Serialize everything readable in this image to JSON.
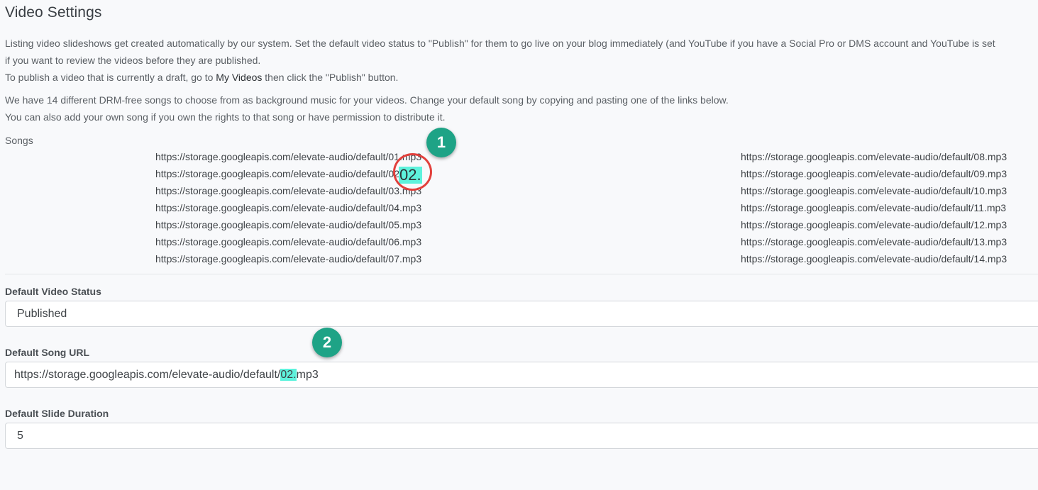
{
  "title": "Video Settings",
  "intro": {
    "line1": "Listing video slideshows get created automatically by our system. Set the default video status to \"Publish\" for them to go live on your blog immediately (and YouTube if you have a Social Pro or DMS account and YouTube is set",
    "line2": "if you want to review the videos before they are published.",
    "line3_prefix": "To publish a video that is currently a draft, go to ",
    "line3_link": "My Videos",
    "line3_suffix": " then click the \"Publish\" button."
  },
  "music": {
    "line1": "We have 14 different DRM-free songs to choose from as background music for your videos. Change your default song by copying and pasting one of the links below.",
    "line2": "You can also add your own song if you own the rights to that song or have permission to distribute it."
  },
  "songs": {
    "label": "Songs",
    "left": [
      "https://storage.googleapis.com/elevate-audio/default/01.mp3",
      "https://storage.googleapis.com/elevate-audio/default/02.mp3",
      "https://storage.googleapis.com/elevate-audio/default/03.mp3",
      "https://storage.googleapis.com/elevate-audio/default/04.mp3",
      "https://storage.googleapis.com/elevate-audio/default/05.mp3",
      "https://storage.googleapis.com/elevate-audio/default/06.mp3",
      "https://storage.googleapis.com/elevate-audio/default/07.mp3"
    ],
    "right": [
      "https://storage.googleapis.com/elevate-audio/default/08.mp3",
      "https://storage.googleapis.com/elevate-audio/default/09.mp3",
      "https://storage.googleapis.com/elevate-audio/default/10.mp3",
      "https://storage.googleapis.com/elevate-audio/default/11.mp3",
      "https://storage.googleapis.com/elevate-audio/default/12.mp3",
      "https://storage.googleapis.com/elevate-audio/default/13.mp3",
      "https://storage.googleapis.com/elevate-audio/default/14.mp3"
    ]
  },
  "annotations": {
    "step1": "1",
    "step2": "2",
    "zoom_text": "02."
  },
  "fields": {
    "status_label": "Default Video Status",
    "status_value": "Published",
    "song_label": "Default Song URL",
    "song_value_prefix": "https://storage.googleapis.com/elevate-audio/default/",
    "song_value_highlight": "02.",
    "song_value_suffix": "mp3",
    "duration_label": "Default Slide Duration",
    "duration_value": "5"
  },
  "colors": {
    "highlight": "#5ef2dc",
    "badge": "#1ea386",
    "marker_ring": "#e2403c"
  }
}
